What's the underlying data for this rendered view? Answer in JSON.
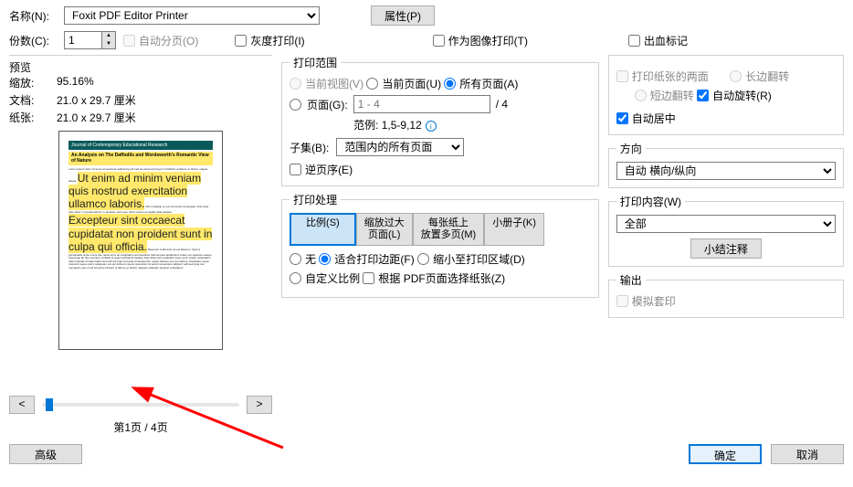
{
  "top": {
    "name_label": "名称(N):",
    "printer": "Foxit PDF Editor Printer",
    "props_btn": "属性(P)",
    "copies_label": "份数(C):",
    "copies_value": "1",
    "collate": "自动分页(O)",
    "grayscale": "灰度打印(I)",
    "as_image": "作为图像打印(T)",
    "bleed": "出血标记"
  },
  "preview": {
    "title": "预览",
    "zoom_label": "缩放:",
    "zoom_value": "95.16%",
    "doc_label": "文档:",
    "doc_value": "21.0 x 29.7 厘米",
    "paper_label": "纸张:",
    "paper_value": "21.0 x 29.7 厘米",
    "page_indicator": "第1页 / 4页",
    "prev": "<",
    "next": ">"
  },
  "range": {
    "title": "打印范围",
    "current_view": "当前视图(V)",
    "current_page": "当前页面(U)",
    "all_pages": "所有页面(A)",
    "pages": "页面(G):",
    "pages_placeholder": "1 - 4",
    "total": "/ 4",
    "example": "范例: 1,5-9,12",
    "subset_label": "子集(B):",
    "subset_value": "范围内的所有页面",
    "reverse": "逆页序(E)"
  },
  "handling": {
    "title": "打印处理",
    "tab_scale": "比例(S)",
    "tab_large": "缩放过大\n页面(L)",
    "tab_multi": "每张纸上\n放置多页(M)",
    "tab_booklet": "小册子(K)",
    "none": "无",
    "fit": "适合打印边距(F)",
    "shrink": "缩小至打印区域(D)",
    "custom": "自定义比例",
    "by_pdf": "根据 PDF页面选择纸张(Z)"
  },
  "duplex": {
    "both_sides": "打印纸张的两面",
    "long_edge": "长边翻转",
    "short_edge": "短边翻转",
    "auto_rotate": "自动旋转(R)",
    "auto_center": "自动居中"
  },
  "orient": {
    "title": "方向",
    "value": "自动 横向/纵向"
  },
  "content": {
    "title": "打印内容(W)",
    "value": "全部",
    "summarize": "小结注释"
  },
  "output": {
    "title": "输出",
    "simulate": "模拟套印"
  },
  "footer": {
    "advanced": "高级",
    "ok": "确定",
    "cancel": "取消"
  }
}
